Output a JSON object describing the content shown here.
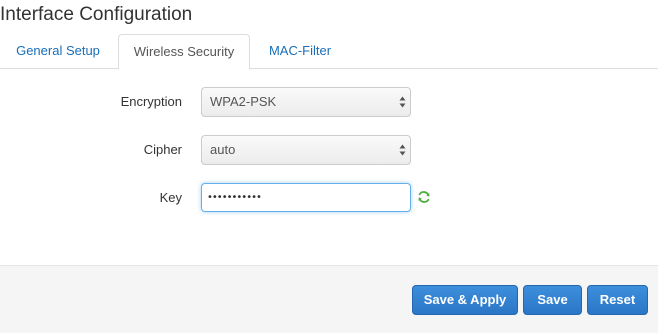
{
  "page": {
    "title": "Interface Configuration"
  },
  "tabs": [
    {
      "label": "General Setup",
      "active": false
    },
    {
      "label": "Wireless Security",
      "active": true
    },
    {
      "label": "MAC-Filter",
      "active": false
    }
  ],
  "form": {
    "encryption": {
      "label": "Encryption",
      "value": "WPA2-PSK"
    },
    "cipher": {
      "label": "Cipher",
      "value": "auto"
    },
    "key": {
      "label": "Key",
      "value": "•••••••••••"
    }
  },
  "footer": {
    "save_apply_label": "Save & Apply",
    "save_label": "Save",
    "reset_label": "Reset"
  },
  "colors": {
    "accent": "#2a76c6",
    "link": "#1a6fb8",
    "refresh_icon": "#4caf3c"
  }
}
